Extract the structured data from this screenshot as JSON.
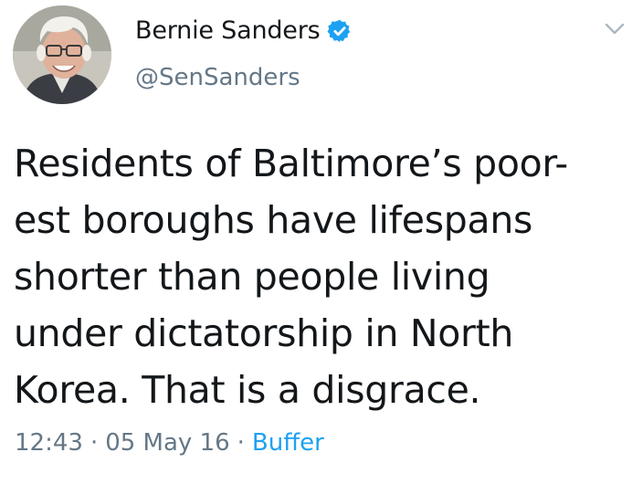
{
  "author": {
    "display_name": "Bernie Sanders",
    "handle": "@SenSanders",
    "verified": true,
    "avatar_icon": "avatar-photo"
  },
  "tweet": {
    "text": "Residents of Baltimore’s poor-\nest boroughs have lifespans\nshorter than people living\nunder dictatorship in North\nKorea. That is a disgrace.",
    "time": "12:43",
    "date": "05 May 16",
    "separator": "·",
    "source": "Buffer"
  },
  "icons": {
    "verified": "verified-badge-icon",
    "menu": "chevron-down-icon"
  },
  "colors": {
    "text": "#14171a",
    "secondary": "#657786",
    "link": "#1da1f2",
    "verified": "#1da1f2"
  }
}
